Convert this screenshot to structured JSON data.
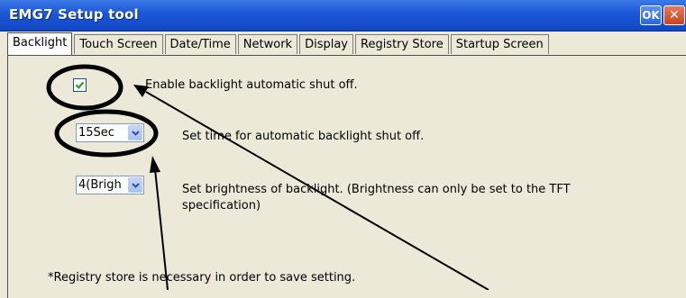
{
  "window": {
    "title": "EMG7 Setup tool",
    "ok_label": "OK",
    "close_label": "✕"
  },
  "tabs": [
    "Backlight",
    "Touch Screen",
    "Date/Time",
    "Network",
    "Display",
    "Registry Store",
    "Startup Screen"
  ],
  "backlight": {
    "auto_shutoff_label": "Enable backlight automatic shut off.",
    "auto_shutoff_checked": true,
    "time_value": "15Sec",
    "time_label": "Set time for automatic backlight shut off.",
    "brightness_value": "4(Brigh",
    "brightness_label_line1": "Set brightness of backlight. (Brightness can only be set to the TFT",
    "brightness_label_line2": "specification)",
    "note": "*Registry store is necessary in order to save setting."
  },
  "colors": {
    "title_bar": "#1a56d6",
    "window_bg": "#ece9d8",
    "checkmark": "#21a121"
  }
}
